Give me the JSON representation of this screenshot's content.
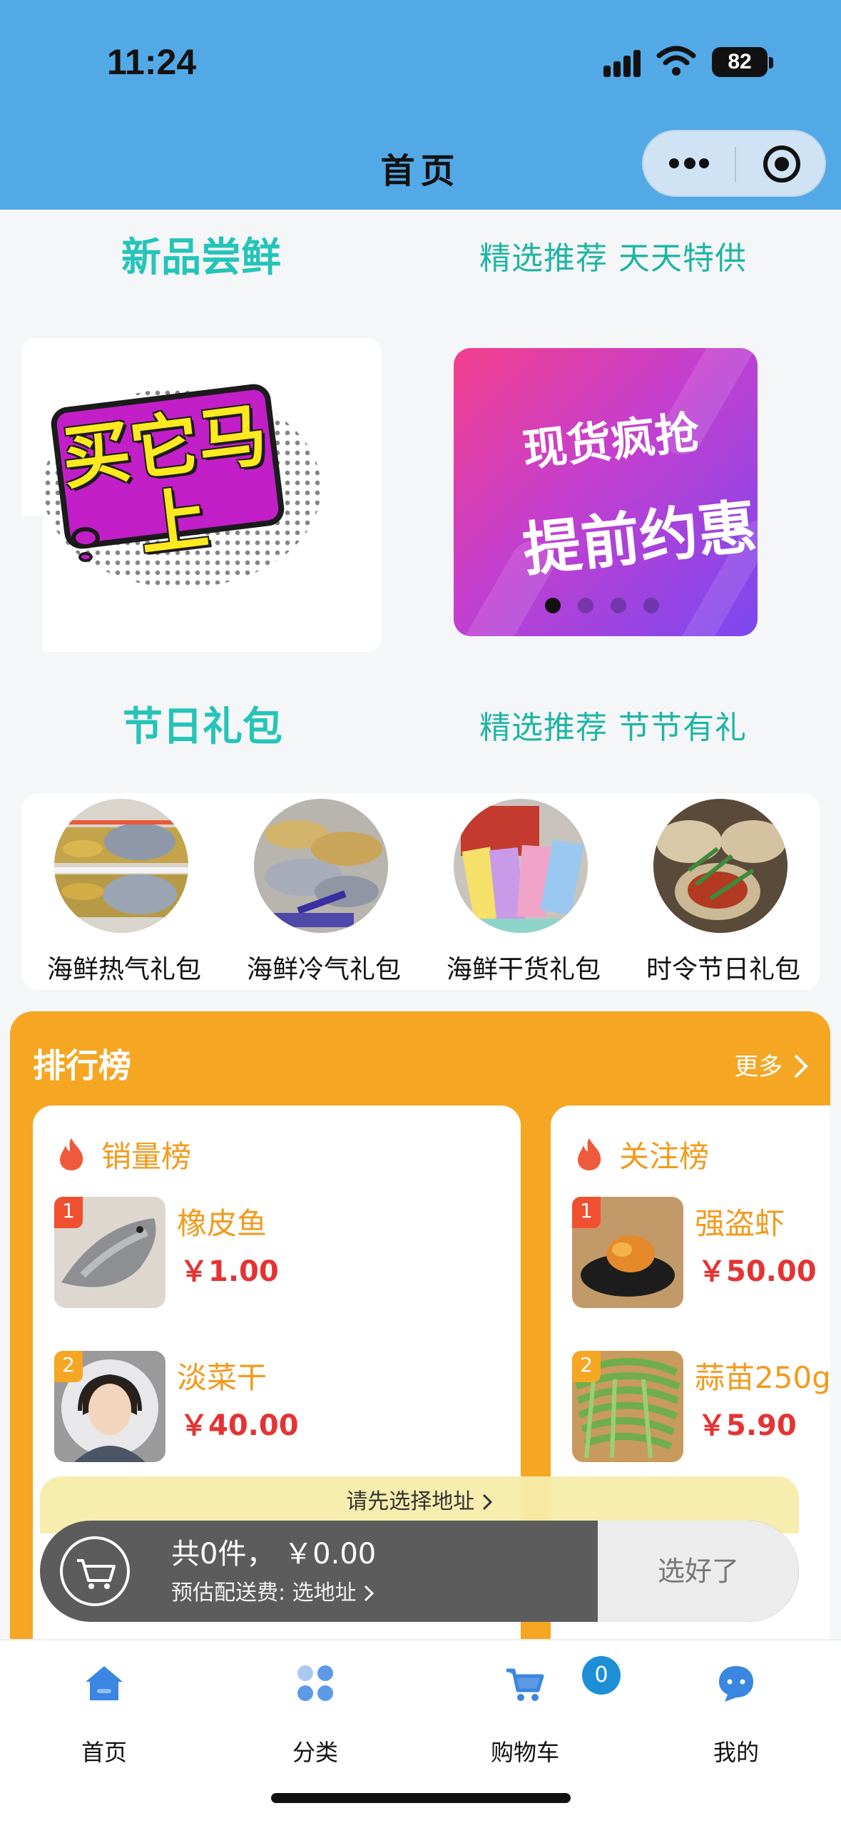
{
  "status_bar": {
    "time": "11:24",
    "battery": "82"
  },
  "nav": {
    "title": "首页"
  },
  "new_section": {
    "title": "新品尝鲜",
    "subtitle": "精选推荐 天天特供"
  },
  "banner": {
    "left_text": "买它马上",
    "right_line1": "现货疯抢",
    "right_line2": "提前约惠",
    "slide_count": 4,
    "active_slide": 1
  },
  "gift_section": {
    "title": "节日礼包",
    "subtitle": "精选推荐 节节有礼"
  },
  "gifts": [
    {
      "label": "海鲜热气礼包"
    },
    {
      "label": "海鲜冷气礼包"
    },
    {
      "label": "海鲜干货礼包"
    },
    {
      "label": "时令节日礼包"
    }
  ],
  "ranking": {
    "title": "排行榜",
    "more": "更多",
    "sales": {
      "title": "销量榜",
      "items": [
        {
          "rank": "1",
          "name": "橡皮鱼",
          "price": "￥1.00"
        },
        {
          "rank": "2",
          "name": "淡菜干",
          "price": "￥40.00"
        }
      ]
    },
    "follow": {
      "title": "关注榜",
      "items": [
        {
          "rank": "1",
          "name": "强盗虾",
          "price": "￥50.00"
        },
        {
          "rank": "2",
          "name": "蒜苗250g",
          "price": "￥5.90"
        }
      ]
    }
  },
  "cart_bar": {
    "address_prompt": "请先选择地址 ",
    "total": "共0件，  ￥0.00",
    "fee": "预估配送费: 选地址 ",
    "confirm": "选好了"
  },
  "tabbar": {
    "items": [
      {
        "label": "首页"
      },
      {
        "label": "分类"
      },
      {
        "label": "购物车"
      },
      {
        "label": "我的"
      }
    ],
    "cart_count": "0"
  },
  "colors": {
    "accent": "#52a9e6",
    "teal": "#25c4b8",
    "orange": "#f5a623",
    "price": "#e53333"
  }
}
